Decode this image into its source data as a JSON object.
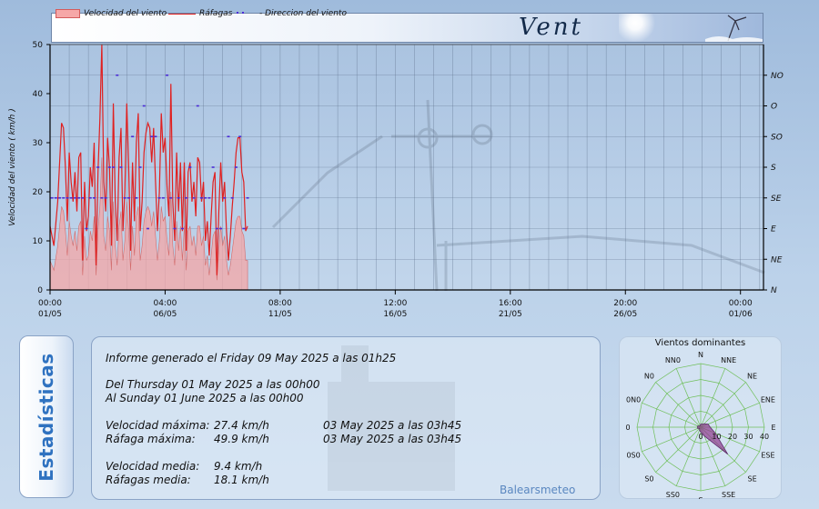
{
  "page": {
    "title": "Vent",
    "legend": {
      "wind_speed": "Velocidad del viento",
      "gusts": "Ráfagas",
      "direction": "- Direccion del viento"
    },
    "brand": "Balearsmeteo"
  },
  "stats": {
    "tab_label": "Estadísticas",
    "report_line": "Informe generado el Friday 09 May 2025 a las 01h25",
    "from_line": "Del Thursday 01 May 2025 a las 00h00",
    "to_line": "Al Sunday 01 June 2025 a las 00h00",
    "rows": [
      {
        "label": "Velocidad máxima:",
        "value": "27.4 km/h",
        "when": "03 May 2025 a las 03h45"
      },
      {
        "label": "Ráfaga máxima:",
        "value": "49.9 km/h",
        "when": "03 May 2025 a las 03h45"
      },
      {
        "label": "Velocidad media:",
        "value": "9.4 km/h",
        "when": ""
      },
      {
        "label": "Ráfagas media:",
        "value": "18.1 km/h",
        "when": ""
      }
    ]
  },
  "colors": {
    "area_fill": "#f4a6a6",
    "gust_line": "#e02020",
    "direction_marker": "#4a2bd6",
    "grid": "#5c6f8a",
    "rose_petal": "#8e3a8e"
  },
  "chart_data": [
    {
      "type": "line",
      "ylabel": "Velocidad del viento ( km/h )",
      "ylim": [
        0,
        50
      ],
      "yticks": [
        0,
        10,
        20,
        30,
        40,
        50
      ],
      "xlim": [
        0,
        744
      ],
      "xticks": [
        {
          "pos": 0,
          "time": "00:00",
          "date": "01/05"
        },
        {
          "pos": 120,
          "time": "04:00",
          "date": "06/05"
        },
        {
          "pos": 240,
          "time": "08:00",
          "date": "11/05"
        },
        {
          "pos": 360,
          "time": "12:00",
          "date": "16/05"
        },
        {
          "pos": 480,
          "time": "16:00",
          "date": "21/05"
        },
        {
          "pos": 600,
          "time": "20:00",
          "date": "26/05"
        },
        {
          "pos": 720,
          "time": "00:00",
          "date": "01/06"
        }
      ],
      "direction_axis": [
        "N",
        "NE",
        "E",
        "SE",
        "S",
        "SO",
        "O",
        "NO"
      ],
      "grid": true,
      "series": [
        {
          "name": "Ráfagas",
          "x": [
            0,
            4,
            8,
            12,
            14,
            16,
            18,
            20,
            22,
            24,
            26,
            28,
            30,
            32,
            34,
            36,
            38,
            40,
            42,
            44,
            46,
            48,
            50,
            52,
            54,
            56,
            58,
            60,
            62,
            64,
            66,
            68,
            70,
            72,
            74,
            76,
            78,
            80,
            82,
            84,
            86,
            88,
            90,
            92,
            94,
            96,
            98,
            100,
            102,
            104,
            106,
            108,
            110,
            112,
            114,
            116,
            118,
            120,
            122,
            124,
            126,
            128,
            130,
            132,
            134,
            136,
            138,
            140,
            142,
            144,
            146,
            148,
            150,
            152,
            154,
            156,
            158,
            160,
            162,
            164,
            166,
            168,
            170,
            172,
            174,
            176,
            178,
            180,
            182,
            184,
            186,
            188,
            190,
            192,
            194,
            196,
            198,
            200,
            202,
            204,
            206
          ],
          "y": [
            13,
            9,
            18,
            34,
            33,
            25,
            14,
            28,
            22,
            18,
            24,
            16,
            27,
            28,
            6,
            22,
            12,
            15,
            25,
            21,
            30,
            5,
            24,
            35,
            50,
            22,
            16,
            31,
            25,
            9,
            38,
            18,
            10,
            27,
            33,
            12,
            20,
            38,
            25,
            8,
            26,
            14,
            30,
            36,
            12,
            18,
            28,
            32,
            34,
            33,
            26,
            33,
            22,
            12,
            20,
            36,
            28,
            31,
            21,
            15,
            42,
            18,
            10,
            28,
            16,
            26,
            12,
            26,
            8,
            24,
            26,
            18,
            22,
            15,
            27,
            26,
            18,
            22,
            10,
            14,
            7,
            15,
            22,
            24,
            3,
            16,
            26,
            18,
            22,
            12,
            6,
            11,
            17,
            22,
            28,
            31,
            31,
            24,
            22,
            12,
            13
          ]
        },
        {
          "name": "Velocidad del viento",
          "x": [
            0,
            4,
            8,
            12,
            14,
            16,
            18,
            20,
            22,
            24,
            26,
            28,
            30,
            32,
            34,
            36,
            38,
            40,
            42,
            44,
            46,
            48,
            50,
            52,
            54,
            56,
            58,
            60,
            62,
            64,
            66,
            68,
            70,
            72,
            74,
            76,
            78,
            80,
            82,
            84,
            86,
            88,
            90,
            92,
            94,
            96,
            98,
            100,
            102,
            104,
            106,
            108,
            110,
            112,
            114,
            116,
            118,
            120,
            122,
            124,
            126,
            128,
            130,
            132,
            134,
            136,
            138,
            140,
            142,
            144,
            146,
            148,
            150,
            152,
            154,
            156,
            158,
            160,
            162,
            164,
            166,
            168,
            170,
            172,
            174,
            176,
            178,
            180,
            182,
            184,
            186,
            188,
            190,
            192,
            194,
            196,
            198,
            200,
            202,
            204,
            206
          ],
          "y": [
            6,
            4,
            9,
            17,
            16,
            12,
            7,
            14,
            11,
            9,
            12,
            8,
            13,
            14,
            3,
            11,
            6,
            7,
            12,
            10,
            15,
            3,
            12,
            17,
            27,
            11,
            8,
            15,
            12,
            4,
            18,
            9,
            5,
            13,
            16,
            6,
            10,
            18,
            12,
            4,
            13,
            7,
            15,
            17,
            6,
            9,
            14,
            16,
            17,
            16,
            13,
            16,
            11,
            6,
            10,
            17,
            14,
            15,
            10,
            7,
            20,
            9,
            5,
            14,
            8,
            13,
            6,
            13,
            4,
            12,
            13,
            9,
            11,
            7,
            13,
            13,
            9,
            11,
            5,
            7,
            3,
            7,
            11,
            12,
            2,
            8,
            13,
            9,
            11,
            6,
            3,
            5,
            8,
            11,
            14,
            15,
            15,
            12,
            11,
            6,
            6
          ]
        },
        {
          "name": "Direccion del viento",
          "x": [
            2,
            6,
            10,
            14,
            18,
            22,
            26,
            30,
            34,
            38,
            42,
            46,
            50,
            54,
            58,
            62,
            66,
            70,
            74,
            78,
            82,
            86,
            90,
            94,
            98,
            102,
            106,
            110,
            114,
            118,
            122,
            126,
            130,
            134,
            138,
            142,
            146,
            150,
            154,
            158,
            162,
            166,
            170,
            174,
            178,
            182,
            186,
            190,
            194,
            198,
            202,
            206
          ],
          "y": [
            "SE",
            "SE",
            "SE",
            "SE",
            "SE",
            "SE",
            "SE",
            "SE",
            "SE",
            "E",
            "SE",
            "SE",
            "S",
            "SE",
            "SE",
            "S",
            "S",
            "NO",
            "S",
            "SE",
            "SE",
            "SO",
            "SE",
            "S",
            "O",
            "E",
            "SO",
            "SO",
            "SE",
            "SE",
            "NO",
            "SE",
            "E",
            "SE",
            "E",
            "SE",
            "S",
            "SE",
            "O",
            "SE",
            "SE",
            "SE",
            "S",
            "E",
            "E",
            "SE",
            "SO",
            "SE",
            "S",
            "SO",
            "E",
            "SE"
          ]
        }
      ]
    },
    {
      "type": "radar",
      "title": "Vientos dominantes",
      "categories": [
        "N",
        "NNE",
        "NE",
        "ENE",
        "E",
        "ESE",
        "SE",
        "SSE",
        "S",
        "SS0",
        "S0",
        "0S0",
        "0",
        "0N0",
        "N0",
        "NN0"
      ],
      "radial_ticks": [
        0,
        10,
        20,
        30,
        40
      ],
      "rlim": [
        0,
        40
      ],
      "values": [
        2,
        2,
        3,
        5,
        6,
        10,
        24,
        6,
        3,
        2,
        1,
        2,
        2,
        2,
        1,
        1
      ]
    }
  ]
}
